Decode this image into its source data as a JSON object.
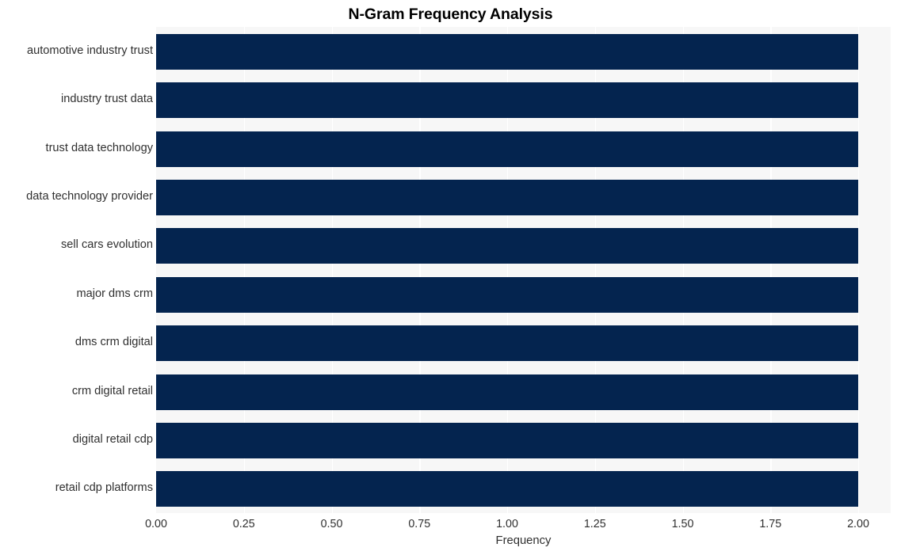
{
  "chart_data": {
    "type": "bar",
    "orientation": "horizontal",
    "title": "N-Gram Frequency Analysis",
    "xlabel": "Frequency",
    "ylabel": "",
    "categories": [
      "automotive industry trust",
      "industry trust data",
      "trust data technology",
      "data technology provider",
      "sell cars evolution",
      "major dms crm",
      "dms crm digital",
      "crm digital retail",
      "digital retail cdp",
      "retail cdp platforms"
    ],
    "values": [
      2,
      2,
      2,
      2,
      2,
      2,
      2,
      2,
      2,
      2
    ],
    "xlim": [
      0,
      2
    ],
    "xticks": [
      0,
      0.25,
      0.5,
      0.75,
      1,
      1.25,
      1.5,
      1.75,
      2
    ],
    "xtick_labels": [
      "0.00",
      "0.25",
      "0.50",
      "0.75",
      "1.00",
      "1.25",
      "1.50",
      "1.75",
      "2.00"
    ],
    "grid": true,
    "grid_axis": "x",
    "legend": false,
    "bar_color": "#04244f",
    "plot_background": "#f7f7f7",
    "figure_background": "#ffffff",
    "gridline_color": "#ffffff",
    "text_color": "#303030",
    "title_color": "#000000"
  }
}
